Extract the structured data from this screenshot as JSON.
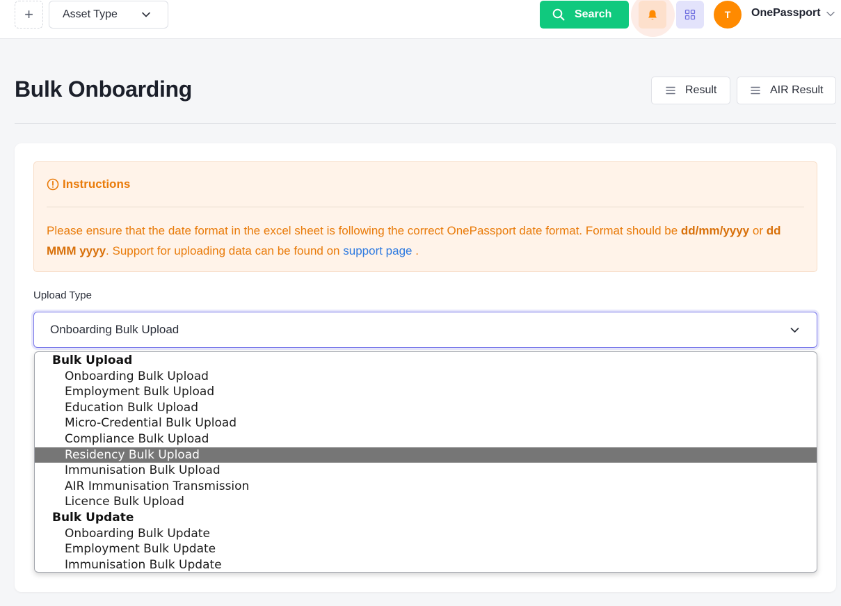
{
  "topbar": {
    "add_icon": "plus-icon",
    "asset_type": {
      "label": "Asset Type",
      "icon": "chevron-down-icon"
    },
    "search": {
      "label": "Search",
      "icon": "search-icon",
      "color": "#10c97e"
    },
    "notifications_icon": "bell-icon",
    "apps_icon": "grid-icon",
    "user": {
      "initial": "T",
      "name": "OnePassport",
      "avatar_color": "#ff8a00"
    }
  },
  "header": {
    "title": "Bulk Onboarding",
    "result_label": "Result",
    "air_result_label": "AIR Result"
  },
  "instructions": {
    "title": "Instructions",
    "text_1": "Please ensure that the date format in the excel sheet is following the correct OnePassport date format. Format should be ",
    "format_1": "dd/mm/yyyy",
    "text_2": " or ",
    "format_2": "dd MMM yyyy",
    "text_3": ". Support for uploading data can be found on ",
    "link": "support page",
    "text_4": " .",
    "accent_color": "#e97b0a"
  },
  "upload": {
    "label": "Upload Type",
    "selected": "Onboarding Bulk Upload"
  },
  "dropdown": {
    "groups": [
      {
        "label": "Bulk Upload",
        "options": [
          "Onboarding Bulk Upload",
          "Employment Bulk Upload",
          "Education Bulk Upload",
          "Micro-Credential Bulk Upload",
          "Compliance Bulk Upload",
          "Residency Bulk Upload",
          "Immunisation Bulk Upload",
          "AIR Immunisation Transmission",
          "Licence Bulk Upload"
        ]
      },
      {
        "label": "Bulk Update",
        "options": [
          "Onboarding Bulk Update",
          "Employment Bulk Update",
          "Immunisation Bulk Update"
        ]
      }
    ],
    "highlighted": "Residency Bulk Upload"
  }
}
